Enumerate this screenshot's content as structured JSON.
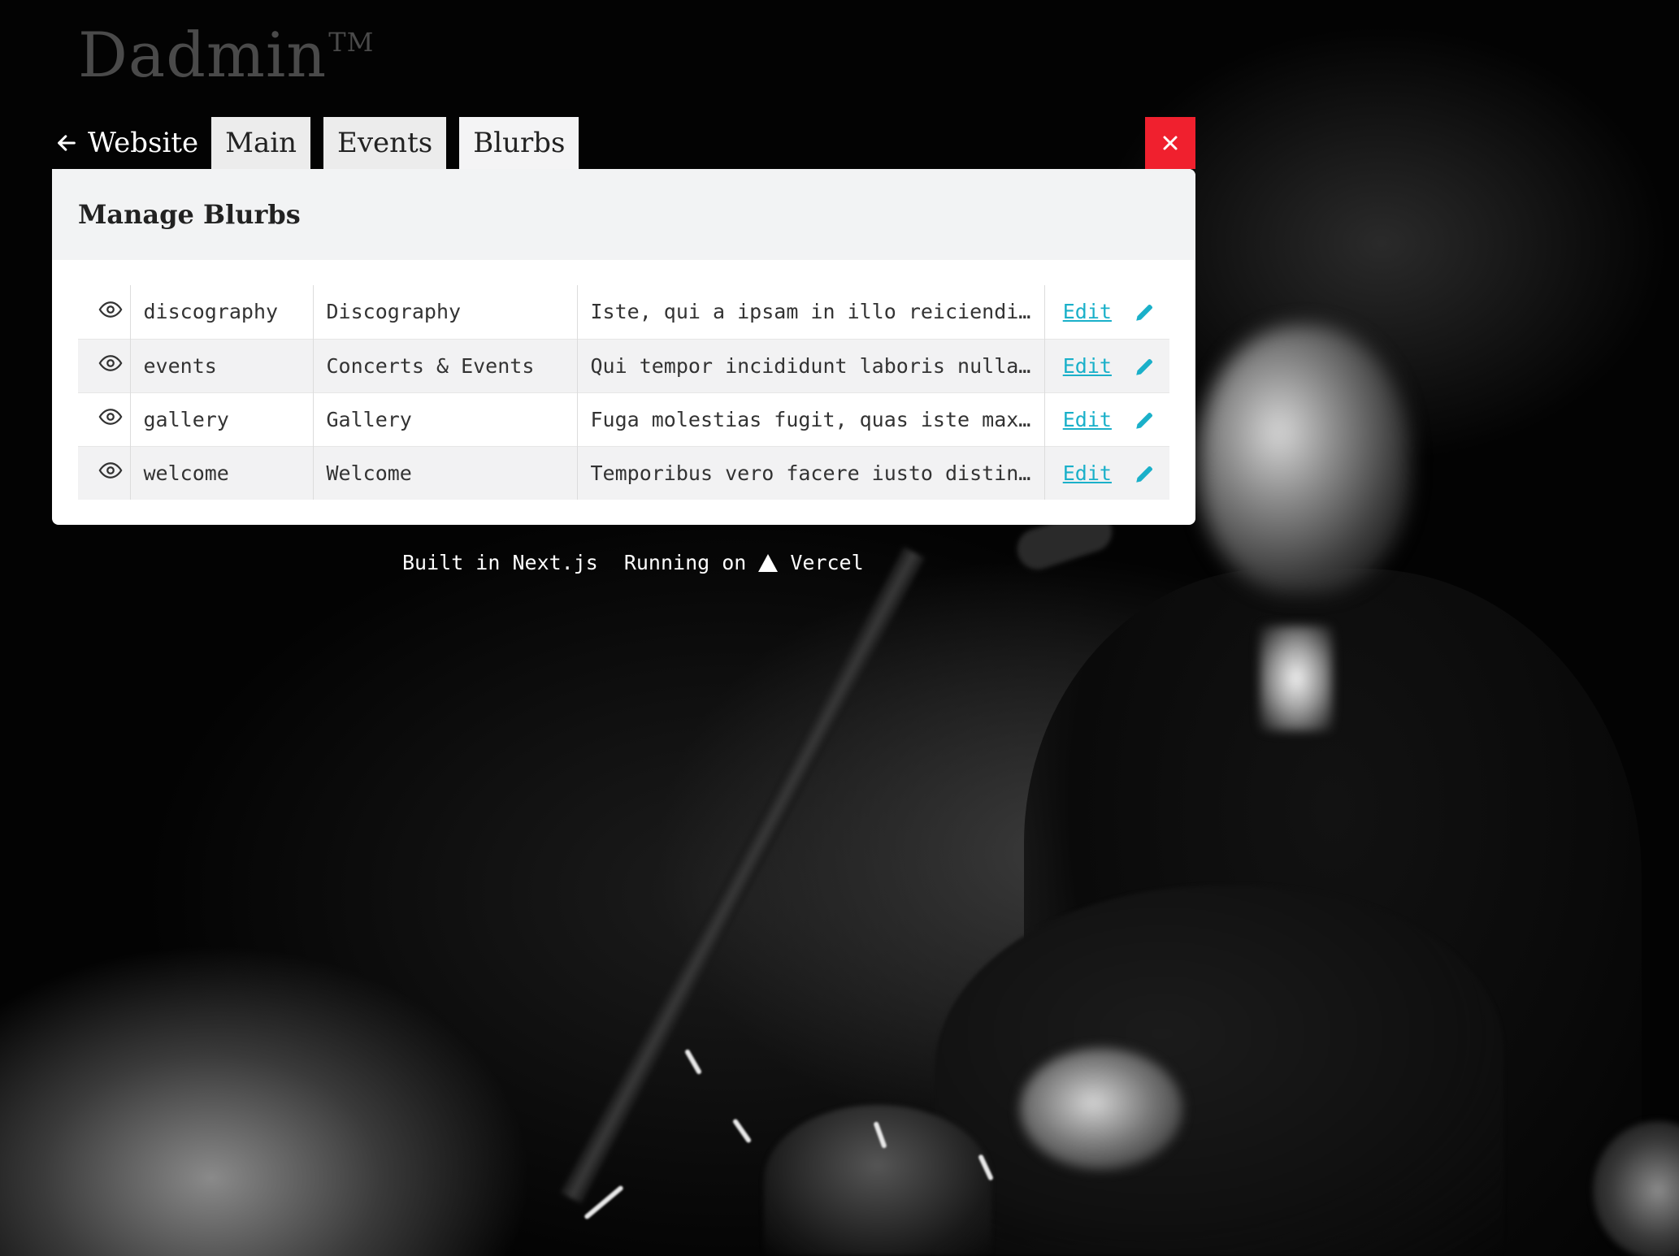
{
  "app": {
    "logo": "Dadmin",
    "logo_mark": "TM"
  },
  "nav": {
    "back_label": "Website",
    "tabs": [
      {
        "label": "Main"
      },
      {
        "label": "Events"
      },
      {
        "label": "Blurbs",
        "active": true
      }
    ],
    "close_icon": "close-icon"
  },
  "panel": {
    "title": "Manage Blurbs",
    "rows": [
      {
        "slug": "discography",
        "title": "Discography",
        "excerpt": "Iste, qui a ipsam in illo reiciendis consequuntur",
        "action": "Edit"
      },
      {
        "slug": "events",
        "title": "Concerts & Events",
        "excerpt": "Qui tempor incididunt laboris nulla aute elit",
        "action": "Edit"
      },
      {
        "slug": "gallery",
        "title": "Gallery",
        "excerpt": "Fuga molestias fugit, quas iste maxime quidem",
        "action": "Edit"
      },
      {
        "slug": "welcome",
        "title": "Welcome",
        "excerpt": "Temporibus vero facere iusto distinctio nihil",
        "action": "Edit"
      }
    ]
  },
  "footer": {
    "built": "Built in Next.js",
    "running": "Running on",
    "host": "Vercel"
  },
  "colors": {
    "accent": "#1ab0c9",
    "close_bg": "#f0202e",
    "panel_header_bg": "#f2f3f4"
  }
}
